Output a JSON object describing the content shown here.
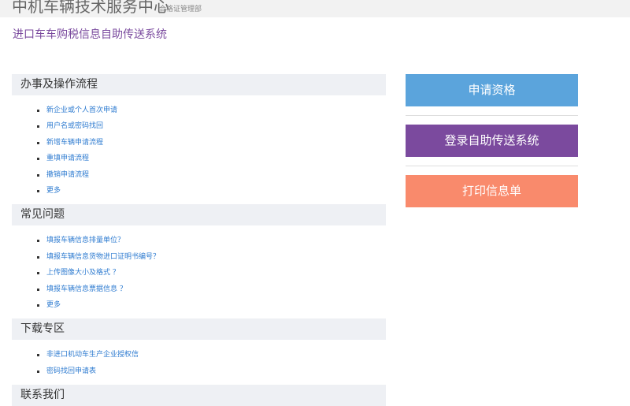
{
  "header": {
    "title": "中机车辆技术服务中心",
    "subtitle": "合格证管理部"
  },
  "system_title": "进口车车购税信息自助传送系统",
  "sections": [
    {
      "title": "办事及操作流程",
      "items": [
        "新企业或个人首次申请",
        "用户名或密码找回",
        "新增车辆申请流程",
        "重填申请流程",
        "撤销申请流程",
        "更多"
      ]
    },
    {
      "title": "常见问题",
      "items": [
        "填报车辆信息排量单位？",
        "填报车辆信息货物进口证明书编号？",
        "上传图像大小及格式 ？",
        "填报车辆信息票据信息 ？",
        "更多"
      ]
    },
    {
      "title": "下载专区",
      "items": [
        "非进口机动车生产企业授权信",
        "密码找回申请表"
      ]
    },
    {
      "title": "联系我们",
      "items": []
    }
  ],
  "actions": {
    "apply": "申请资格",
    "login": "登录自助传送系统",
    "print": "打印信息单"
  },
  "colors": {
    "apply": "#5ba4dc",
    "login": "#7b4a9e",
    "print": "#f98a6c",
    "link": "#2e7bd0",
    "subtitle": "#7a4a9e"
  }
}
